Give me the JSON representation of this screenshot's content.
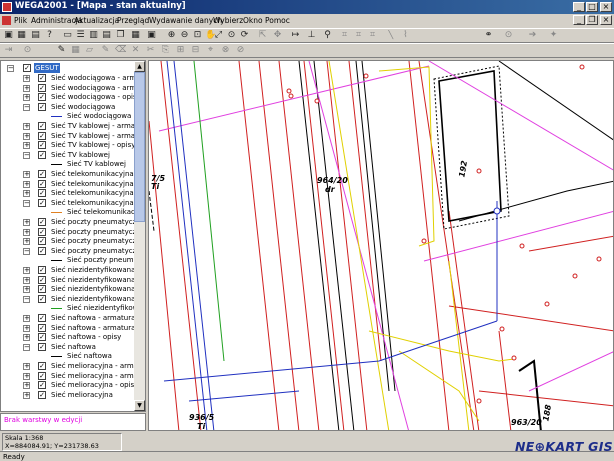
{
  "window": {
    "title": "WEGA2001 - [Mapa - stan aktualny]"
  },
  "menu": [
    "Plik",
    "Administracja",
    "Aktualizacja",
    "Przegląd",
    "Wydawanie danych",
    "Wybierz",
    "Okno",
    "Pomoc"
  ],
  "tree": {
    "root": "GESUT",
    "rows": [
      {
        "kind": "item",
        "exp": "+",
        "label": "Sieć wodociągowa - armatura"
      },
      {
        "kind": "item",
        "exp": "+",
        "label": "Sieć wodociągowa - armatura"
      },
      {
        "kind": "item",
        "exp": "+",
        "label": "Sieć wodociągowa - opisy"
      },
      {
        "kind": "item",
        "exp": "-",
        "label": "Sieć wodociągowa"
      },
      {
        "kind": "legend",
        "label": "Sieć wodociągowa",
        "color": "#2030c0"
      },
      {
        "kind": "item",
        "exp": "+",
        "label": "Sieć TV kablowej - armatura"
      },
      {
        "kind": "item",
        "exp": "+",
        "label": "Sieć TV kablowej - armatura"
      },
      {
        "kind": "item",
        "exp": "+",
        "label": "Sieć TV kablowej - opisy"
      },
      {
        "kind": "item",
        "exp": "-",
        "label": "Sieć TV kablowej"
      },
      {
        "kind": "legend",
        "label": "Sieć TV kablowej",
        "color": "#000000"
      },
      {
        "kind": "item",
        "exp": "+",
        "label": "Sieć telekomunikacyjna - arm"
      },
      {
        "kind": "item",
        "exp": "+",
        "label": "Sieć telekomunikacyjna - arm"
      },
      {
        "kind": "item",
        "exp": "+",
        "label": "Sieć telekomunikacyjna - opi"
      },
      {
        "kind": "item",
        "exp": "-",
        "label": "Sieć telekomunikacyjna"
      },
      {
        "kind": "legend",
        "label": "Sieć telekomunikacyjna",
        "color": "#e08020"
      },
      {
        "kind": "item",
        "exp": "+",
        "label": "Sieć poczty pneumatycznej -"
      },
      {
        "kind": "item",
        "exp": "+",
        "label": "Sieć poczty pneumatycznej -"
      },
      {
        "kind": "item",
        "exp": "+",
        "label": "Sieć poczty pneumatycznej -"
      },
      {
        "kind": "item",
        "exp": "-",
        "label": "Sieć poczty pneumatycznej"
      },
      {
        "kind": "legend",
        "label": "Sieć poczty pneumatycznej",
        "color": "#000000"
      },
      {
        "kind": "item",
        "exp": "+",
        "label": "Sieć niezidentyfikowana - arr"
      },
      {
        "kind": "item",
        "exp": "+",
        "label": "Sieć niezidentyfikowana - arr"
      },
      {
        "kind": "item",
        "exp": "+",
        "label": "Sieć niezidentyfikowana - opi"
      },
      {
        "kind": "item",
        "exp": "-",
        "label": "Sieć niezidentyfikowana"
      },
      {
        "kind": "legend",
        "label": "Sieć niezidentyfikowana",
        "color": "#20a020"
      },
      {
        "kind": "item",
        "exp": "+",
        "label": "Sieć naftowa - armatura"
      },
      {
        "kind": "item",
        "exp": "+",
        "label": "Sieć naftowa - armatura"
      },
      {
        "kind": "item",
        "exp": "+",
        "label": "Sieć naftowa - opisy"
      },
      {
        "kind": "item",
        "exp": "-",
        "label": "Sieć naftowa"
      },
      {
        "kind": "legend",
        "label": "Sieć naftowa",
        "color": "#000000"
      },
      {
        "kind": "item",
        "exp": "+",
        "label": "Sieć melioracyjna - armatura"
      },
      {
        "kind": "item",
        "exp": "+",
        "label": "Sieć melioracyjna - armatura"
      },
      {
        "kind": "item",
        "exp": "+",
        "label": "Sieć melioracyjna - opisy"
      },
      {
        "kind": "item",
        "exp": "+",
        "label": "Sieć melioracyjna"
      }
    ]
  },
  "info": {
    "message": "Brak warstwy w edycji"
  },
  "coords": {
    "scale": "Skala 1:368",
    "xy": "X=884084.91; Y=231738.63"
  },
  "status": {
    "text": "Ready"
  },
  "logo": "NE⊕KART GIS",
  "map_labels": [
    "7/5",
    "Ti",
    "964/20",
    "dr",
    "192",
    "936/5",
    "Ti",
    "963/20",
    "188"
  ],
  "colors": {
    "titlebar": "#0a246a",
    "selection": "#316ac5",
    "info_text": "#e000e0",
    "logo": "#1d2d8a"
  }
}
